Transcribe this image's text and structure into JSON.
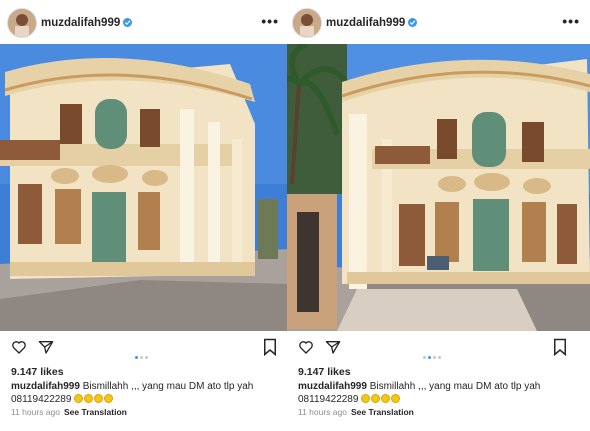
{
  "posts": [
    {
      "username": "muzdalifah999",
      "more_label": "•••",
      "likes": "9.147 likes",
      "caption_user": "muzdalifah999",
      "caption_text": "Bismillahh ,,, yang mau DM ato tlp yah",
      "caption_phone": "08119422289",
      "emojis": [
        "smiling-face",
        "smiling-face",
        "smiling-face",
        "smiling-face"
      ],
      "time": "11 hours ago",
      "see_translation": "See Translation",
      "carousel_dots": 3,
      "active_dot": 1
    },
    {
      "username": "muzdalifah999",
      "more_label": "•••",
      "likes": "9.147 likes",
      "caption_user": "muzdalifah999",
      "caption_text": "Bismillahh ,,, yang mau DM ato tlp yah",
      "caption_phone": "08119422289",
      "emojis": [
        "smiling-face",
        "smiling-face",
        "smiling-face",
        "smiling-face"
      ],
      "time": "11 hours ago",
      "see_translation": "See Translation",
      "carousel_dots": 4,
      "active_dot": 1
    }
  ],
  "colors": {
    "verified": "#3897f0",
    "sky": "#3d7fd6",
    "facade": "#f1e3c4",
    "trim": "#c99b5f",
    "window_green": "#5f8f78",
    "pavement": "#a9a29c"
  },
  "icons": [
    "heart-icon",
    "comment-icon",
    "share-icon",
    "bookmark-icon",
    "verified-badge-icon"
  ]
}
